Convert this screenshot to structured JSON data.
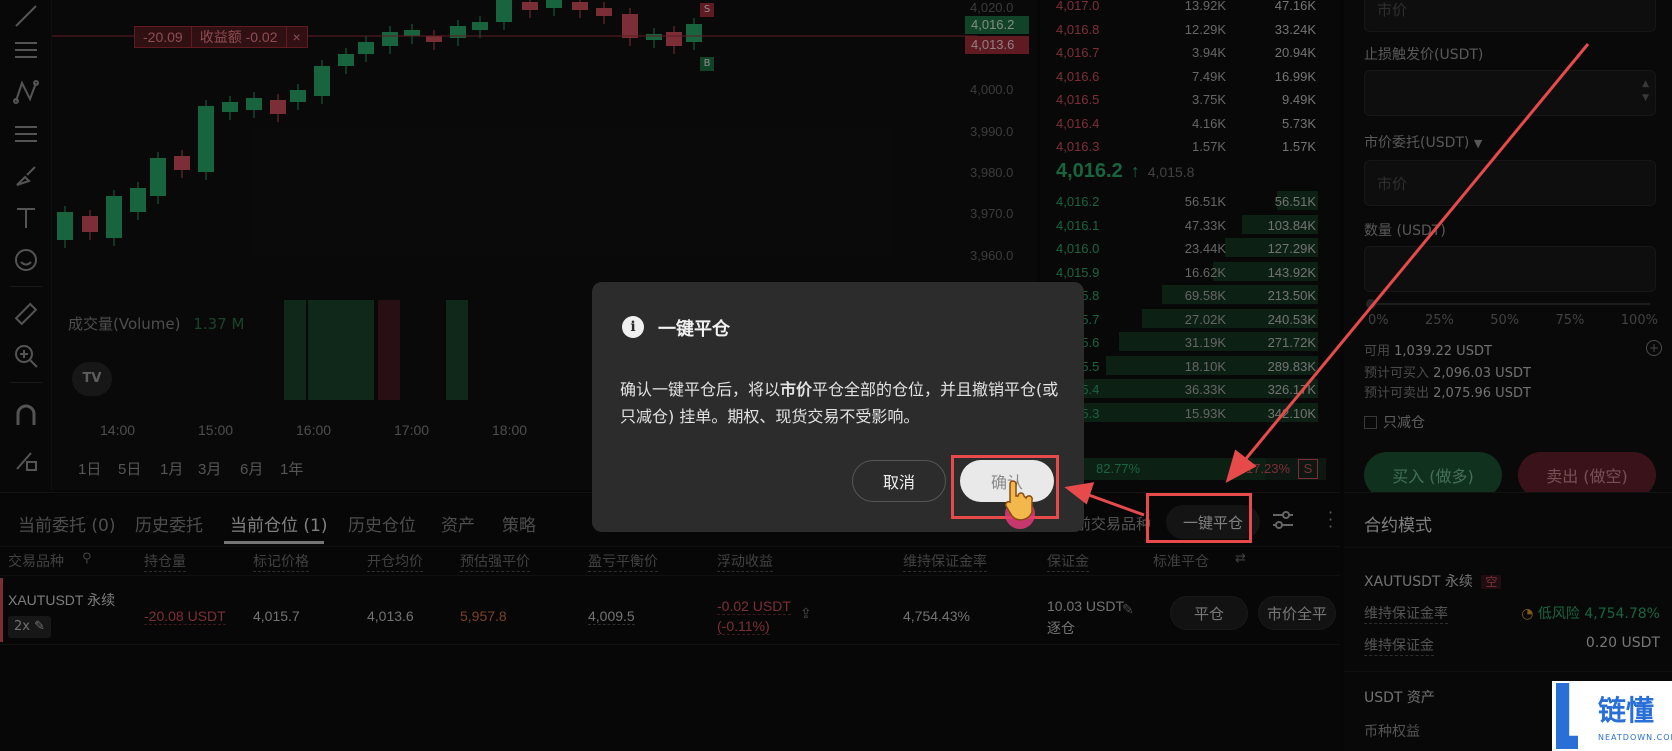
{
  "chart": {
    "volume_label": "成交量(Volume)",
    "volume_value": "1.37 M",
    "pnl_tag": {
      "value": "-20.09",
      "label": "收益额 -0.02",
      "close": "×"
    },
    "price_axis": [
      "4,020.0",
      "4,000.0",
      "3,990.0",
      "3,980.0",
      "3,970.0",
      "3,960.0"
    ],
    "price_tags": [
      {
        "value": "4,016.2",
        "color": "#1f7a4a"
      },
      {
        "value": "4,013.6",
        "color": "#b0303f"
      }
    ],
    "markers": {
      "sell": "S",
      "buy": "B"
    },
    "time_axis": [
      "14:00",
      "15:00",
      "16:00",
      "17:00",
      "18:00"
    ],
    "ranges": [
      "1日",
      "5日",
      "1月",
      "3月",
      "6月",
      "1年"
    ],
    "tv_logo": "TV"
  },
  "orderbook": {
    "asks": [
      {
        "price": "4,017.0",
        "size": "13.92K",
        "total": "47.16K"
      },
      {
        "price": "4,016.8",
        "size": "12.29K",
        "total": "33.24K"
      },
      {
        "price": "4,016.7",
        "size": "3.94K",
        "total": "20.94K"
      },
      {
        "price": "4,016.6",
        "size": "7.49K",
        "total": "16.99K"
      },
      {
        "price": "4,016.5",
        "size": "3.75K",
        "total": "9.49K"
      },
      {
        "price": "4,016.4",
        "size": "4.16K",
        "total": "5.73K"
      },
      {
        "price": "4,016.3",
        "size": "1.57K",
        "total": "1.57K"
      }
    ],
    "last_price": "4,016.2",
    "last_arrow": "↑",
    "mark_price": "4,015.8",
    "bids": [
      {
        "price": "4,016.2",
        "size": "56.51K",
        "total": "56.51K"
      },
      {
        "price": "4,016.1",
        "size": "47.33K",
        "total": "103.84K"
      },
      {
        "price": "4,016.0",
        "size": "23.44K",
        "total": "127.29K"
      },
      {
        "price": "4,015.9",
        "size": "16.62K",
        "total": "143.92K"
      },
      {
        "price": "4,015.8",
        "size": "69.58K",
        "total": "213.50K"
      },
      {
        "price": "4,015.7",
        "size": "27.02K",
        "total": "240.53K"
      },
      {
        "price": "4,015.6",
        "size": "31.19K",
        "total": "271.72K"
      },
      {
        "price": "4,015.5",
        "size": "18.10K",
        "total": "289.83K"
      },
      {
        "price": "4,015.4",
        "size": "36.33K",
        "total": "326.17K"
      },
      {
        "price": "4,015.3",
        "size": "15.93K",
        "total": "342.10K"
      }
    ],
    "ratio_buy": "82.77%",
    "ratio_sell": "17.23%",
    "ratio_sell_tag": "S"
  },
  "orderform": {
    "price_placeholder": "市价",
    "stop_label": "止损触发价(USDT)",
    "market_label": "市价委托(USDT)",
    "market_placeholder": "市价",
    "qty_label": "数量 (USDT)",
    "slider_marks": [
      "0%",
      "25%",
      "50%",
      "75%",
      "100%"
    ],
    "available_label": "可用",
    "available_value": "1,039.22 USDT",
    "buy_est_label": "预计可买入",
    "buy_est_value": "2,096.03 USDT",
    "sell_est_label": "预计可卖出",
    "sell_est_value": "2,075.96 USDT",
    "reduce_only": "只减仓",
    "buy_button": "买入 (做多)",
    "sell_button": "卖出 (做空)"
  },
  "bottom": {
    "tabs": [
      "当前委托 (0)",
      "历史委托",
      "当前仓位 (1)",
      "历史仓位",
      "资产",
      "策略"
    ],
    "current_symbol_filter": "前交易品种",
    "close_all_button": "一键平仓",
    "columns": [
      "交易品种",
      "持仓量",
      "标记价格",
      "开仓均价",
      "预估强平价",
      "盈亏平衡价",
      "浮动收益",
      "维持保证金率",
      "保证金",
      "标准平仓"
    ],
    "row": {
      "symbol": "XAUTUSDT 永续",
      "leverage": "2x",
      "size": "-20.08 USDT",
      "mark": "4,015.7",
      "entry": "4,013.6",
      "liq": "5,957.8",
      "breakeven": "4,009.5",
      "pnl": "-0.02 USDT",
      "pnl_pct": "(-0.11%)",
      "mmr": "4,754.43%",
      "margin": "10.03 USDT",
      "margin_mode": "逐仓",
      "close_btn": "平仓",
      "market_close_btn": "市价全平"
    }
  },
  "contract": {
    "title": "合约模式",
    "symbol": "XAUTUSDT 永续",
    "side": "空",
    "mmr_label": "维持保证金率",
    "mmr_value": "低风险 4,754.78%",
    "mm_label": "维持保证金",
    "mm_value": "0.20 USDT",
    "asset_title": "USDT 资产",
    "equity_label": "币种权益"
  },
  "modal": {
    "title": "一键平仓",
    "body_1": "确认一键平仓后，将以",
    "body_bold": "市价",
    "body_2": "平仓全部的仓位，并且撤销平仓(或只减仓) 挂单。期权、现货交易不受影响。",
    "cancel": "取消",
    "confirm": "确认"
  },
  "watermark": {
    "text": "链懂",
    "sub": "NEATDOWN.COM"
  },
  "colors": {
    "up": "#2bb673",
    "down": "#e25563",
    "annotation": "#e64a4a"
  }
}
